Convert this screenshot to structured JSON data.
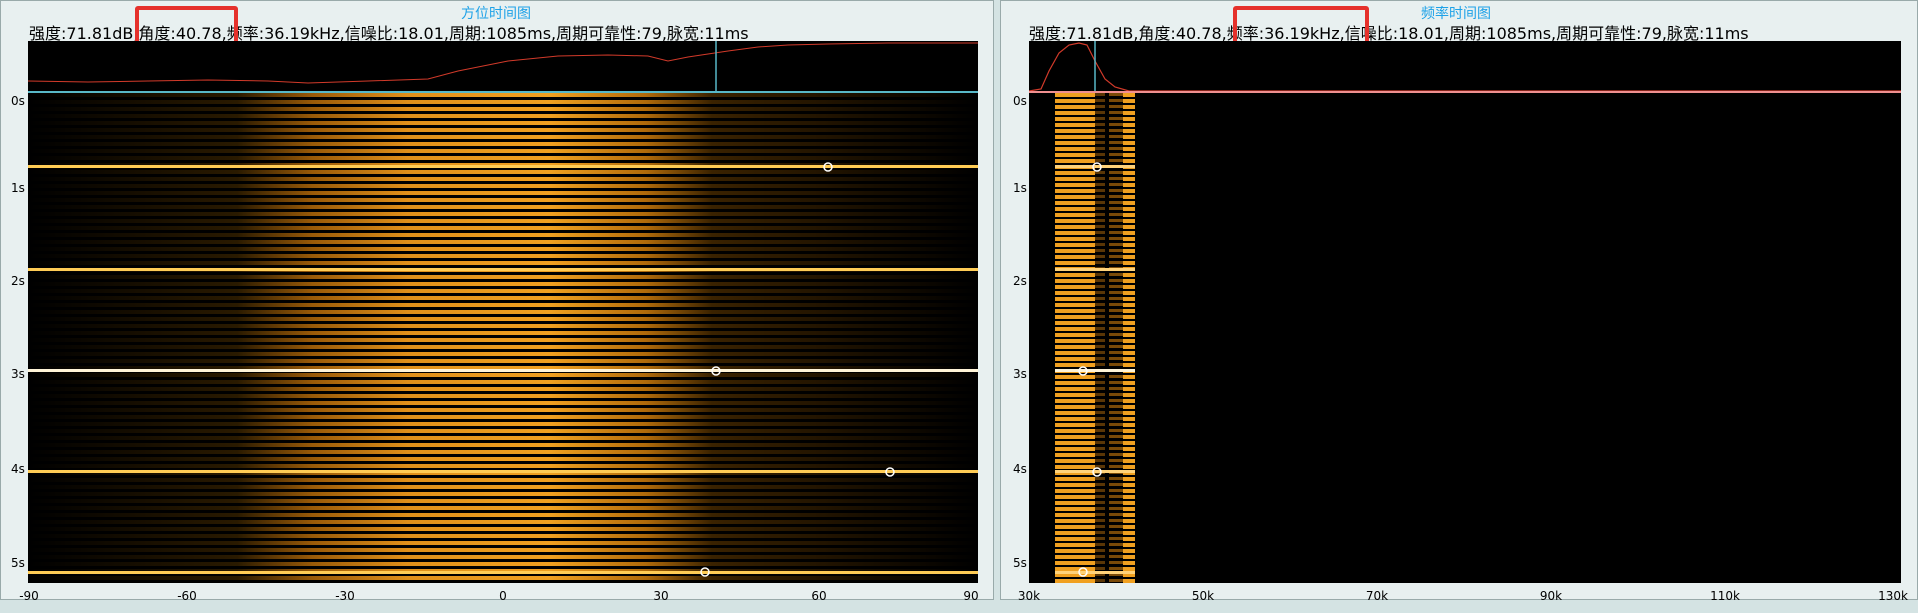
{
  "left_panel": {
    "title": "方位时间图",
    "info": {
      "strength": "强度:71.81dB,",
      "angle": "角度:40.78,",
      "frequency": "频率:36.19kHz,",
      "snr": "信噪比:18.01,",
      "period": "周期:1085ms,",
      "period_reliability": "周期可靠性:79,",
      "pulse_width": "脉宽:11ms"
    },
    "highlighted_field": "angle",
    "y_ticks": [
      "0s",
      "1s",
      "2s",
      "3s",
      "4s",
      "5s"
    ],
    "x_ticks": [
      "-90",
      "-60",
      "-30",
      "0",
      "30",
      "60",
      "90"
    ]
  },
  "right_panel": {
    "title": "频率时间图",
    "info": {
      "strength": "强度:71.81dB,",
      "angle": "角度:40.78,",
      "frequency": "频率:36.19kHz,",
      "snr": "信噪比:18.01,",
      "period": "周期:1085ms,",
      "period_reliability": "周期可靠性:79,",
      "pulse_width": "脉宽:11ms"
    },
    "highlighted_field": "frequency",
    "y_ticks": [
      "0s",
      "1s",
      "2s",
      "3s",
      "4s",
      "5s"
    ],
    "x_ticks": [
      "30k",
      "50k",
      "70k",
      "90k",
      "110k",
      "130k"
    ]
  },
  "colors": {
    "background": "#d4e3e3",
    "title": "#1ea2e8",
    "highlight": "#e5312b",
    "signal": "#ffa31a",
    "trace": "#d23a2a",
    "cursor": "#58b8c8",
    "plot_bg": "#000000"
  },
  "chart_data": [
    {
      "type": "heatmap",
      "title": "方位时间图",
      "x_range": [
        -90,
        90
      ],
      "y_range_s": [
        0,
        5.2
      ],
      "pulse_times_s": [
        0.72,
        1.82,
        2.95,
        4.03,
        5.1
      ],
      "detections": [
        {
          "angle": 62,
          "t": 0.72
        },
        {
          "angle": 40.78,
          "t": 2.95
        },
        {
          "angle": 74,
          "t": 4.03
        },
        {
          "angle": 38,
          "t": 5.1
        }
      ],
      "cursor_angle": 40.78
    },
    {
      "type": "heatmap",
      "title": "频率时间图",
      "x_range_khz": [
        30,
        130
      ],
      "y_range_s": [
        0,
        5.2
      ],
      "band_khz": [
        33.5,
        37.5
      ],
      "detections": [
        {
          "freq_khz": 37.9,
          "t": 0.72
        },
        {
          "freq_khz": 36.3,
          "t": 2.95
        },
        {
          "freq_khz": 37.9,
          "t": 4.03
        },
        {
          "freq_khz": 36.3,
          "t": 5.1
        }
      ],
      "cursor_khz": 37.6
    }
  ]
}
